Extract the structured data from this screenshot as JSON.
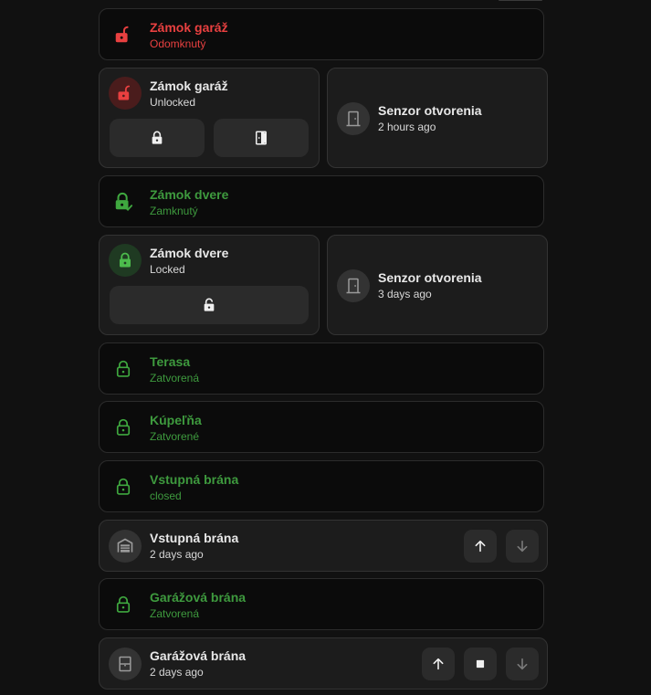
{
  "colors": {
    "red": "#e84040",
    "green": "#3e9a3e",
    "background": "#111111"
  },
  "rows": [
    {
      "title": "Zámok garáž",
      "state": "Odomknutý",
      "icon": "lock-open-icon"
    },
    {
      "title": "Zámok dvere",
      "state": "Zamknutý",
      "icon": "lock-check-icon"
    },
    {
      "title": "Terasa",
      "state": "Zatvorená",
      "icon": "lock-icon"
    },
    {
      "title": "Kúpeľňa",
      "state": "Zatvorené",
      "icon": "lock-icon"
    },
    {
      "title": "Vstupná brána",
      "state": "closed",
      "icon": "lock-icon"
    },
    {
      "title": "Garážová brána",
      "state": "Zatvorená",
      "icon": "lock-icon"
    }
  ],
  "tiles": {
    "garage_lock": {
      "title": "Zámok garáž",
      "state": "Unlocked",
      "icon": "lock-open-icon"
    },
    "garage_sensor": {
      "title": "Senzor otvorenia",
      "state": "2 hours ago",
      "icon": "door-icon"
    },
    "door_lock": {
      "title": "Zámok dvere",
      "state": "Locked",
      "icon": "lock-icon"
    },
    "door_sensor": {
      "title": "Senzor otvorenia",
      "state": "3 days ago",
      "icon": "door-icon"
    },
    "entry_gate": {
      "title": "Vstupná brána",
      "state": "2 days ago",
      "icon": "gate-icon"
    },
    "garage_door": {
      "title": "Garážová brána",
      "state": "2 days ago",
      "icon": "garage-door-icon"
    }
  }
}
